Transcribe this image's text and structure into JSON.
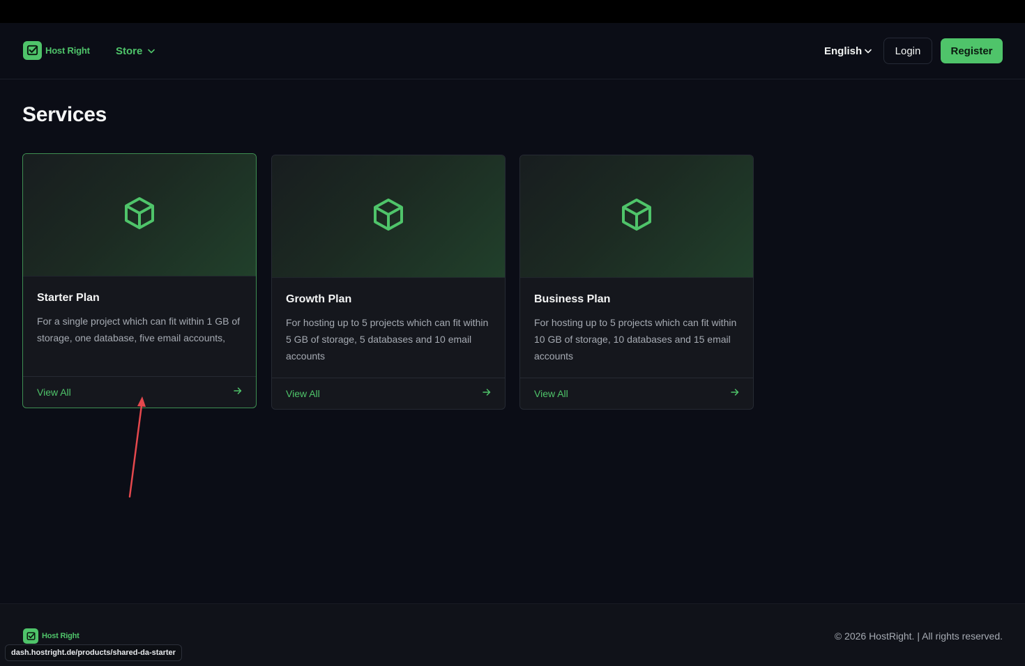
{
  "brand": {
    "name": "Host Right",
    "accent": "#4fc46a"
  },
  "nav": {
    "store_label": "Store",
    "language_label": "English",
    "login_label": "Login",
    "register_label": "Register"
  },
  "page": {
    "title": "Services"
  },
  "plans": [
    {
      "title": "Starter Plan",
      "description": "For a single project which can fit within 1 GB of storage, one database, five email accounts,",
      "link_label": "View All",
      "icon": "cube-icon",
      "active": true
    },
    {
      "title": "Growth Plan",
      "description": "For hosting up to 5 projects which can fit within 5 GB of storage, 5 databases and 10 email accounts",
      "link_label": "View All",
      "icon": "cube-icon",
      "active": false
    },
    {
      "title": "Business Plan",
      "description": "For hosting up to 5 projects which can fit within 10 GB of storage, 10 databases and 15 email accounts",
      "link_label": "View All",
      "icon": "cube-icon",
      "active": false
    }
  ],
  "footer": {
    "brand": "Host Right",
    "copyright": "© 2026 HostRight. | All rights reserved."
  },
  "status_bar": {
    "url": "dash.hostright.de/products/shared-da-starter"
  },
  "annotation": {
    "color": "#e5484d"
  }
}
